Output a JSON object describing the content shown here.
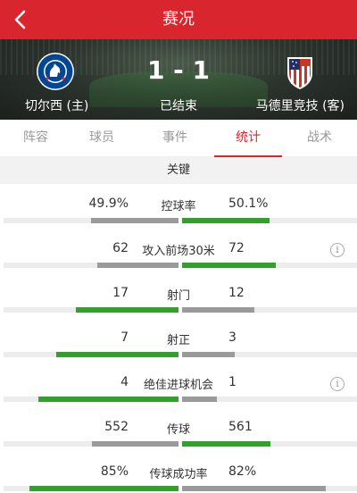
{
  "header": {
    "title": "赛况"
  },
  "match": {
    "home_team": "切尔西 (主)",
    "away_team": "马德里竞技 (客)",
    "score": "1 - 1",
    "status": "已结束",
    "home_crest_text": "CHELSEA FOOTBALL CLUB"
  },
  "tabs": [
    {
      "label": "阵容"
    },
    {
      "label": "球员"
    },
    {
      "label": "事件"
    },
    {
      "label": "统计",
      "active": true
    },
    {
      "label": "战术"
    }
  ],
  "section_title": "关键",
  "stats": [
    {
      "name": "控球率",
      "home": "49.9%",
      "away": "50.1%",
      "home_frac": 0.499,
      "away_frac": 0.501,
      "winner": "away",
      "info": false
    },
    {
      "name": "攻入前场30米",
      "home": "62",
      "away": "72",
      "home_frac": 0.463,
      "away_frac": 0.537,
      "winner": "away",
      "info": true
    },
    {
      "name": "射门",
      "home": "17",
      "away": "12",
      "home_frac": 0.586,
      "away_frac": 0.414,
      "winner": "home",
      "info": false
    },
    {
      "name": "射正",
      "home": "7",
      "away": "3",
      "home_frac": 0.7,
      "away_frac": 0.3,
      "winner": "home",
      "info": false
    },
    {
      "name": "绝佳进球机会",
      "home": "4",
      "away": "1",
      "home_frac": 0.8,
      "away_frac": 0.2,
      "winner": "home",
      "info": true
    },
    {
      "name": "传球",
      "home": "552",
      "away": "561",
      "home_frac": 0.496,
      "away_frac": 0.504,
      "winner": "away",
      "info": false
    },
    {
      "name": "传球成功率",
      "home": "85%",
      "away": "82%",
      "home_frac": 0.85,
      "away_frac": 0.82,
      "winner": "home",
      "info": false
    }
  ],
  "colors": {
    "brand": "#d9262e",
    "win": "#33a02c",
    "lose": "#9a9a9a"
  },
  "icons": {
    "back": "chevron-left-icon",
    "info": "info-icon"
  }
}
